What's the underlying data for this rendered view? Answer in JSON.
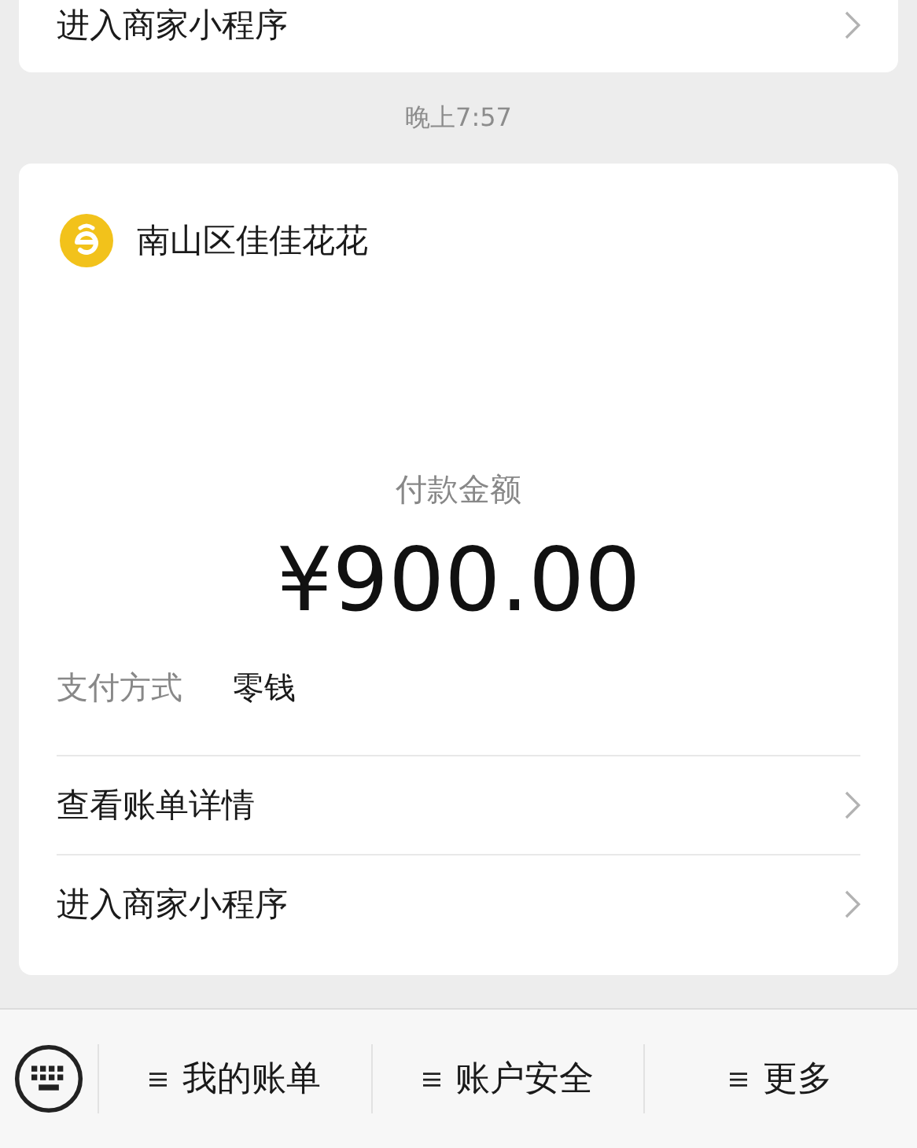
{
  "previous_card": {
    "link": "进入商家小程序"
  },
  "time": "晚上7:57",
  "payment_card": {
    "merchant": "南山区佳佳花花",
    "amount_label": "付款金额",
    "amount": "¥900.00",
    "details": [
      {
        "label": "支付方式",
        "value": "零钱"
      }
    ],
    "links": [
      "查看账单详情",
      "进入商家小程序"
    ]
  },
  "bottom_menu": [
    "我的账单",
    "账户安全",
    "更多"
  ]
}
